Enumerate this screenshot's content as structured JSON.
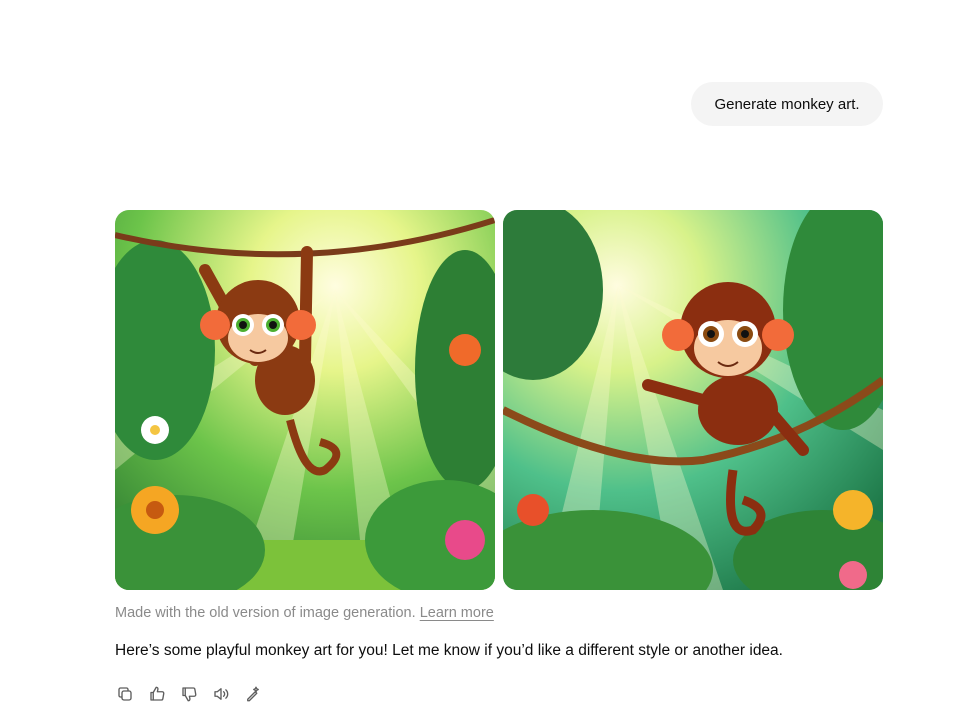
{
  "user_message": "Generate monkey art.",
  "images": [
    {
      "alt": "Cartoon monkey hanging from a vine in a sunny jungle"
    },
    {
      "alt": "Cartoon monkey swinging on a rope in a sunny jungle"
    }
  ],
  "caption": {
    "text": "Made with the old version of image generation.",
    "link": "Learn more"
  },
  "assistant_reply": "Here’s some playful monkey art for you! Let me know if you’d like a different style or another idea.",
  "actions": [
    {
      "icon": "copy-icon"
    },
    {
      "icon": "thumbs-up-icon"
    },
    {
      "icon": "thumbs-down-icon"
    },
    {
      "icon": "read-aloud-icon"
    },
    {
      "icon": "edit-image-icon"
    }
  ]
}
